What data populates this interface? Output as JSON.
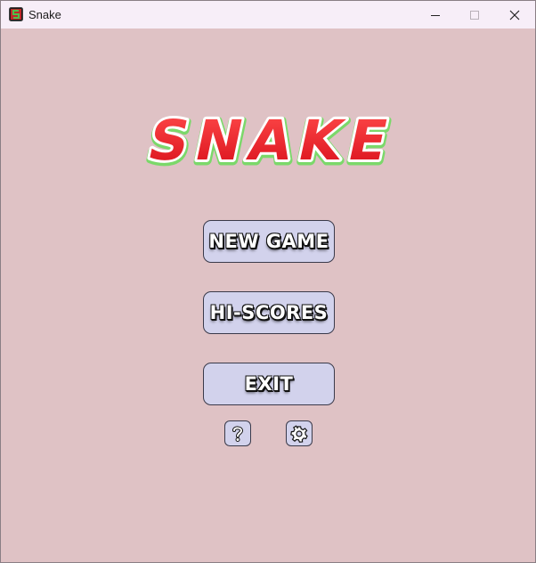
{
  "window": {
    "title": "Snake",
    "icons": {
      "app": "snake-app-icon",
      "minimize": "minimize-icon",
      "maximize": "maximize-icon",
      "close": "close-icon"
    }
  },
  "game": {
    "title": "SNAKE",
    "colors": {
      "background": "#dfc2c5",
      "title_red": "#e8202a",
      "title_outline": "#ffffff",
      "title_glow": "#7bd86a",
      "button_bg": "#d2d2ec"
    }
  },
  "menu": {
    "new_game": "NEW GAME",
    "hi_scores": "HI-SCORES",
    "exit": "EXIT",
    "help_icon": "question-mark-icon",
    "settings_icon": "gear-icon"
  }
}
